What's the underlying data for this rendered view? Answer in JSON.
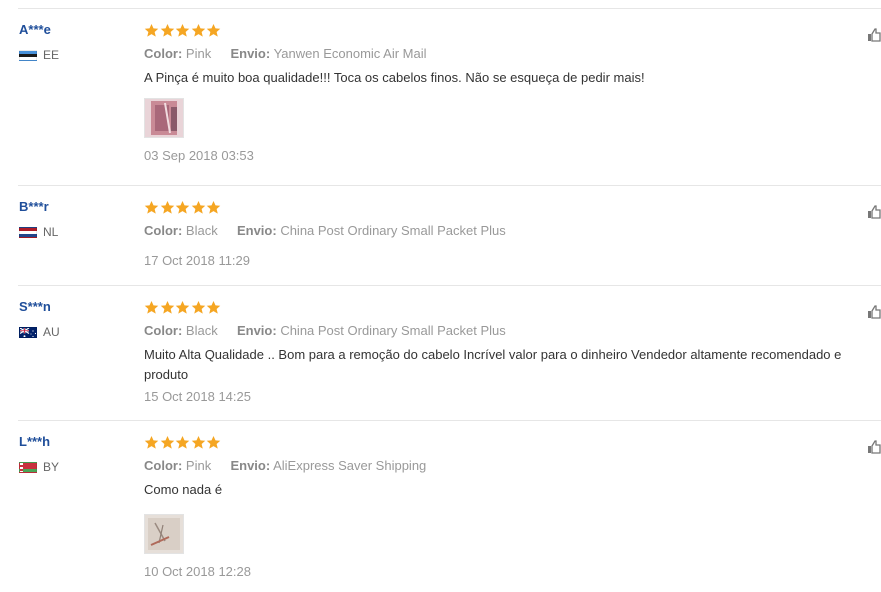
{
  "colors": {
    "star": "#f5a623",
    "username": "#1f4e9a",
    "muted": "#999999",
    "divider": "#e6e6e6"
  },
  "icons": {
    "star": "star-icon",
    "helpful": "thumbs-up-icon",
    "flag": "flag-icon"
  },
  "reviews": [
    {
      "user": "A***e",
      "country": "EE",
      "rating": 5,
      "color_label": "Color:",
      "color_value": "Pink",
      "shipping_label": "Envio:",
      "shipping_value": "Yanwen Economic Air Mail",
      "text": "A Pinça é muito boa qualidade!!! Toca os cabelos finos. Não se esqueça de pedir mais!",
      "date": "03 Sep 2018 03:53"
    },
    {
      "user": "B***r",
      "country": "NL",
      "rating": 5,
      "color_label": "Color:",
      "color_value": "Black",
      "shipping_label": "Envio:",
      "shipping_value": "China Post Ordinary Small Packet Plus",
      "text": "",
      "date": "17 Oct 2018 11:29"
    },
    {
      "user": "S***n",
      "country": "AU",
      "rating": 5,
      "color_label": "Color:",
      "color_value": "Black",
      "shipping_label": "Envio:",
      "shipping_value": "China Post Ordinary Small Packet Plus",
      "text": "Muito Alta Qualidade .. Bom para a remoção do cabelo Incrível valor para o dinheiro Vendedor altamente recomendado e produto",
      "date": "15 Oct 2018 14:25"
    },
    {
      "user": "L***h",
      "country": "BY",
      "rating": 5,
      "color_label": "Color:",
      "color_value": "Pink",
      "shipping_label": "Envio:",
      "shipping_value": "AliExpress Saver Shipping",
      "text": "Como nada é",
      "date": "10 Oct 2018 12:28"
    }
  ]
}
